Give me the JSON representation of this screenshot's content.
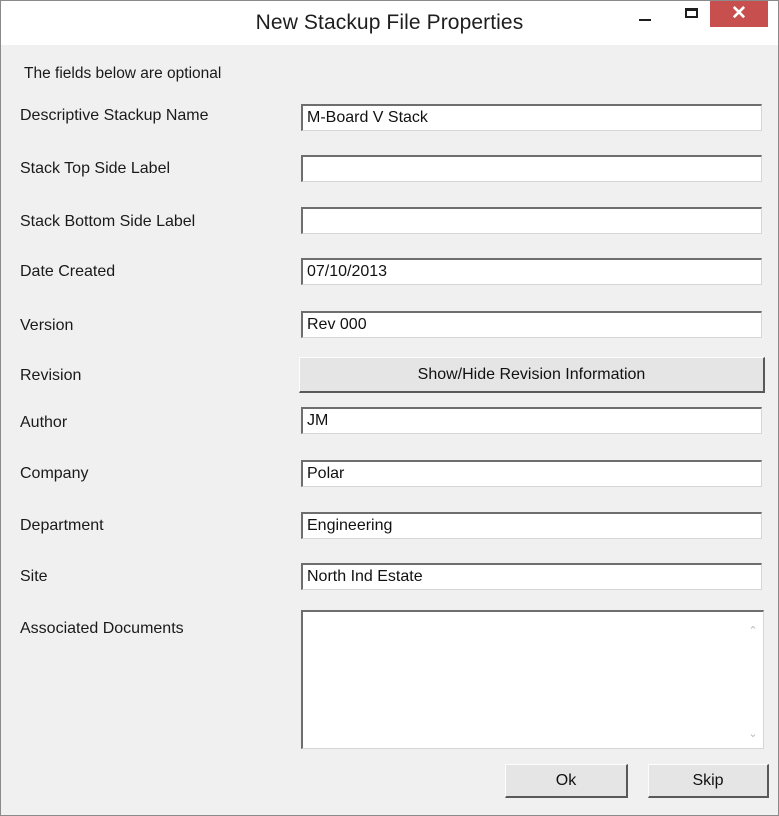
{
  "window": {
    "title": "New Stackup File Properties",
    "close_glyph": "✕",
    "close_color": "#c7504f"
  },
  "form": {
    "hint": "The fields below are optional",
    "fields": [
      {
        "label": "Descriptive Stackup Name",
        "value": "M-Board V Stack"
      },
      {
        "label": "Stack Top Side Label",
        "value": ""
      },
      {
        "label": "Stack Bottom Side Label",
        "value": ""
      },
      {
        "label": "Date Created",
        "value": "07/10/2013"
      },
      {
        "label": "Version",
        "value": "Rev 000"
      }
    ],
    "revision_label": "Revision",
    "revision_button": "Show/Hide Revision Information",
    "fields2": [
      {
        "label": "Author",
        "value": "JM"
      },
      {
        "label": "Company",
        "value": "Polar"
      },
      {
        "label": "Department",
        "value": "Engineering"
      },
      {
        "label": "Site",
        "value": "North Ind Estate"
      }
    ],
    "associated_label": "Associated Documents",
    "associated_value": "",
    "scroll_up_glyph": "⌃",
    "scroll_down_glyph": "⌄"
  },
  "buttons": {
    "ok": "Ok",
    "skip": "Skip"
  }
}
